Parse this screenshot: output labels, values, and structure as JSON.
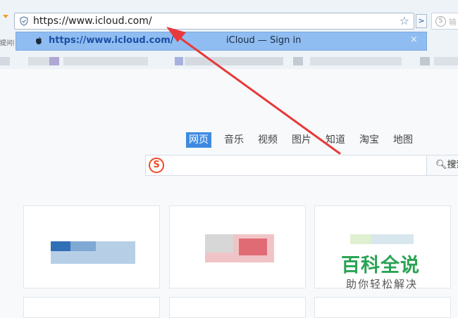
{
  "address_bar": {
    "url": "https://www.icloud.com/",
    "search_hint": "输"
  },
  "left_panel_text": "提问排",
  "suggestion": {
    "url": "https://www.icloud.com/",
    "title": "iCloud — Sign in",
    "close": "×"
  },
  "search_nav": {
    "tabs": [
      "网页",
      "音乐",
      "视频",
      "图片",
      "知道",
      "淘宝",
      "地图"
    ],
    "active_index": 0
  },
  "search": {
    "logo_letter": "S",
    "button_label": "搜索"
  },
  "watermark": {
    "title": "百科全说",
    "subtitle": "助你轻松解决"
  },
  "icons": {
    "shield": "shield-icon",
    "star": "star-icon",
    "go": "chevron-right-icon",
    "apple": "apple-icon",
    "sogou": "sogou-logo-icon",
    "search": "search-icon"
  },
  "colors": {
    "suggestion_bg": "#90bdf1",
    "active_tab": "#3f8ae0",
    "watermark_green": "#2aa354",
    "arrow_red": "#e8393a"
  }
}
